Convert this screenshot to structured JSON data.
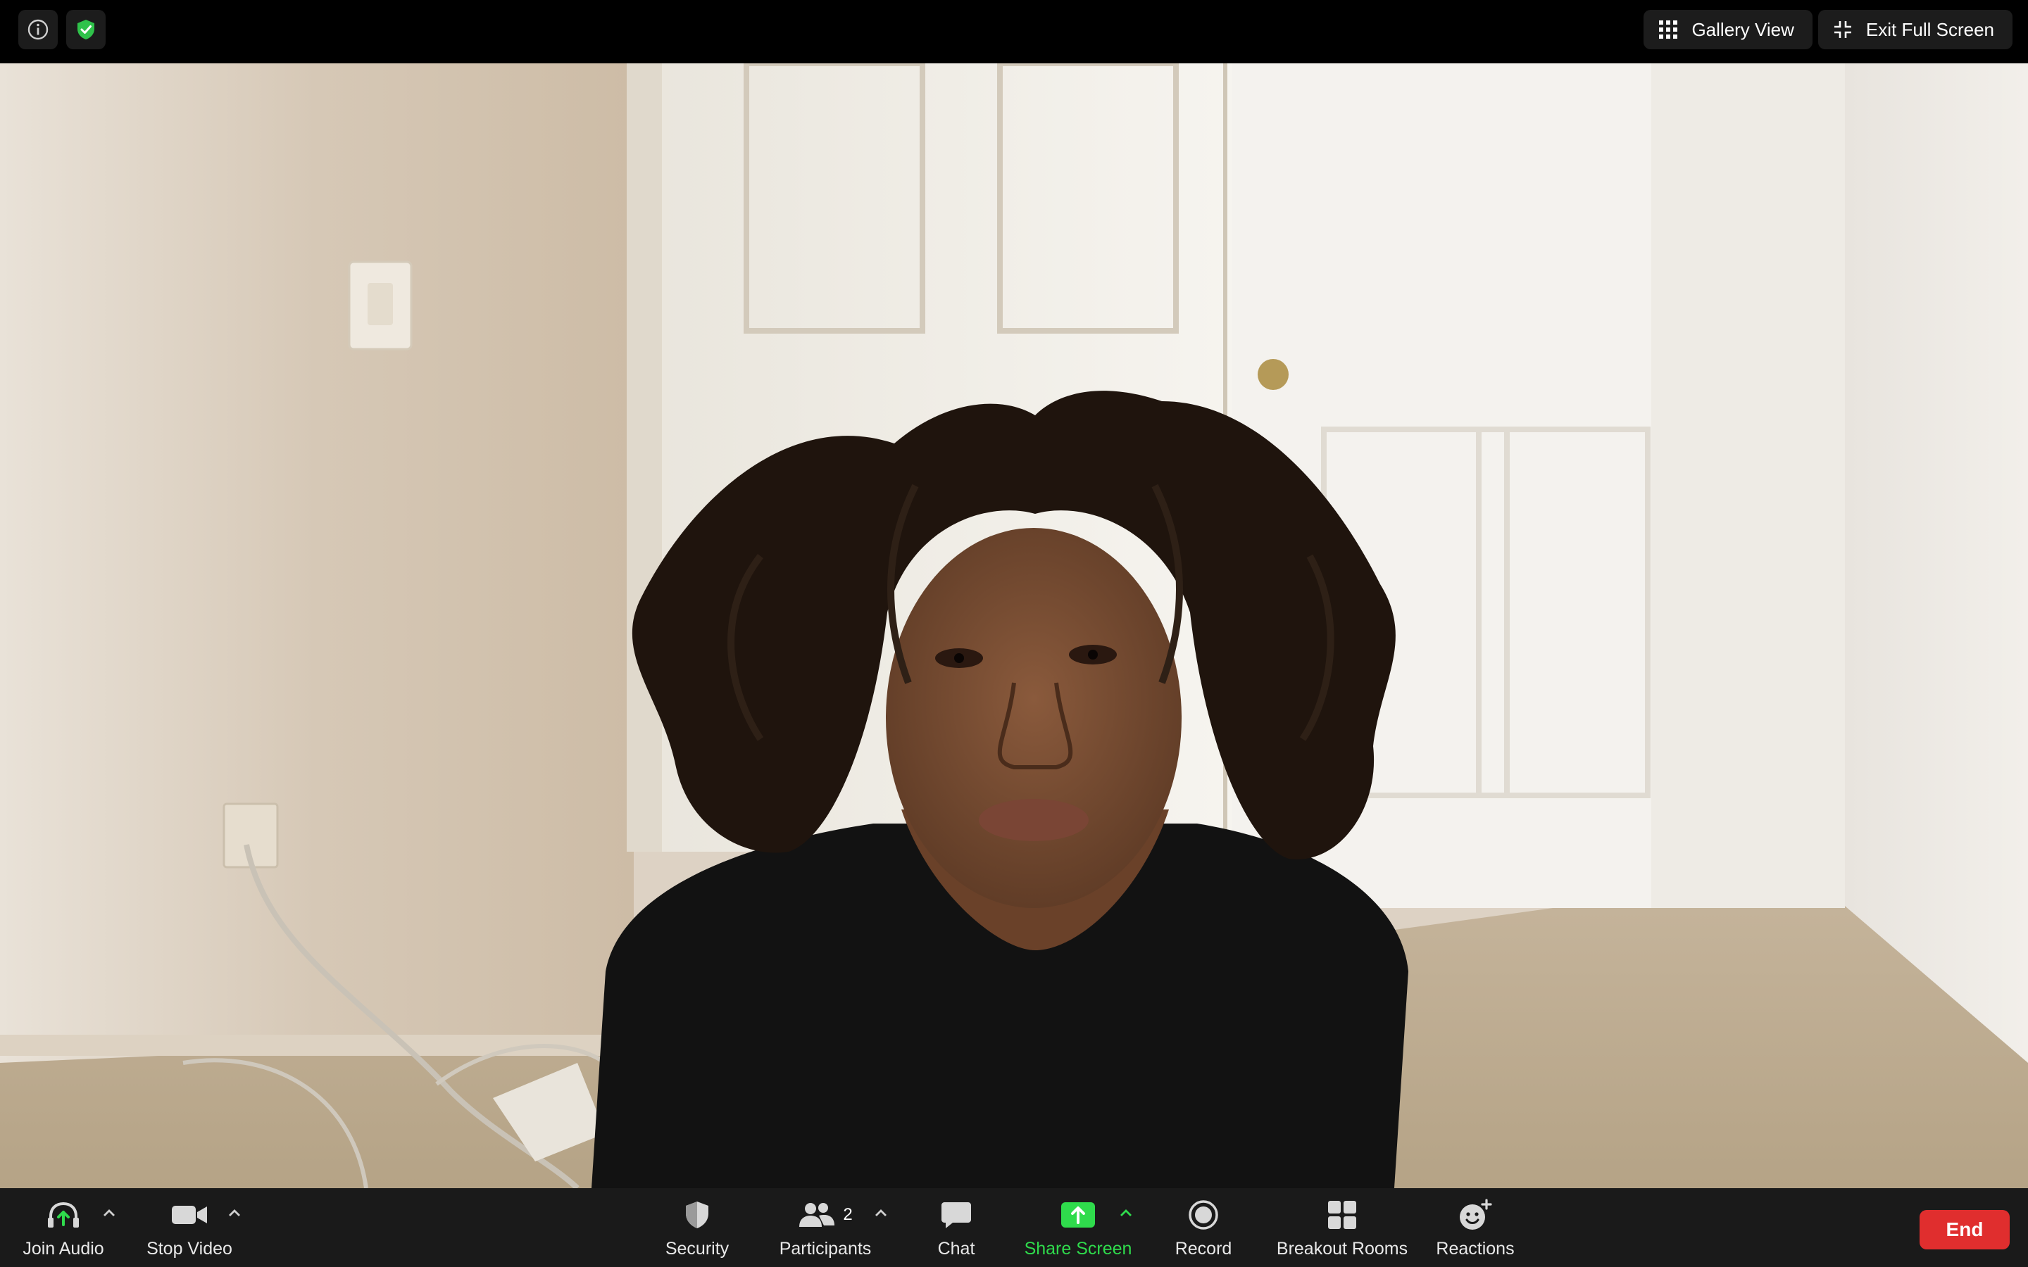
{
  "top_bar": {
    "gallery_view_label": "Gallery View",
    "exit_full_screen_label": "Exit Full Screen",
    "icons": [
      "info-icon",
      "shield-check-icon",
      "grid-icon",
      "exit-fullscreen-icon"
    ],
    "shield_color": "#2fc24a"
  },
  "toolbar": {
    "join_audio": "Join Audio",
    "stop_video": "Stop Video",
    "security": "Security",
    "participants": "Participants",
    "participants_count": "2",
    "chat": "Chat",
    "share_screen": "Share Screen",
    "record": "Record",
    "breakout_rooms": "Breakout Rooms",
    "reactions": "Reactions",
    "end": "End",
    "colors": {
      "share_green": "#2fdb4c",
      "end_red": "#e02e2e"
    }
  }
}
